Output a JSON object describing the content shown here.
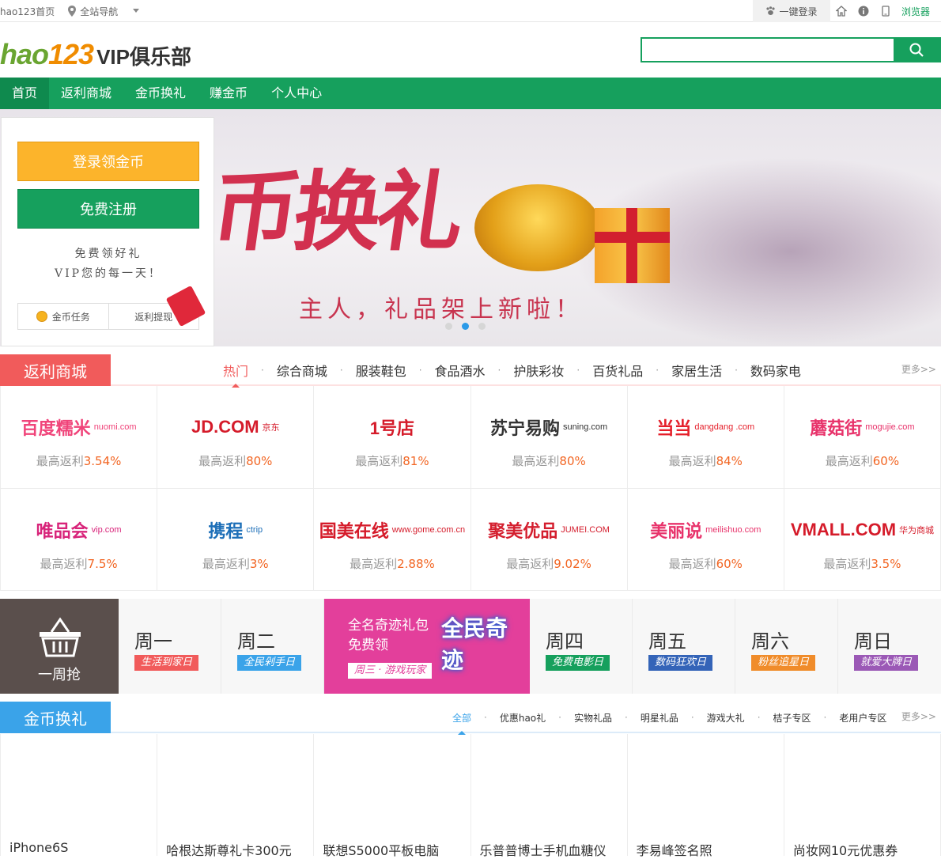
{
  "topbar": {
    "home": "hao123首页",
    "sitenav": "全站导航",
    "login": "一键登录",
    "browser": "浏览器"
  },
  "header": {
    "logo_hao": "hao",
    "logo_num": "123",
    "logo_vip": "VIP俱乐部",
    "search_placeholder": ""
  },
  "nav": {
    "items": [
      "首页",
      "返利商城",
      "金币换礼",
      "赚金币",
      "个人中心"
    ]
  },
  "banner": {
    "headline": "币换礼",
    "subtitle": "主人，礼品架上新啦！"
  },
  "login_box": {
    "login_button": "登录领金币",
    "register_button": "免费注册",
    "slogan_line1": "免费领好礼",
    "slogan_line2": "VIP您的每一天！",
    "task_label": "金币任务",
    "withdraw_label": "返利提现"
  },
  "rebate": {
    "title": "返利商城",
    "tabs": [
      "热门",
      "综合商城",
      "服装鞋包",
      "食品酒水",
      "护肤彩妆",
      "百货礼品",
      "家居生活",
      "数码家电"
    ],
    "more": "更多>>",
    "rate_prefix": "最高返利",
    "stores": [
      {
        "name": "百度糯米",
        "sub": "nuomi.com",
        "color": "#f0447a",
        "rate": "3.54%"
      },
      {
        "name": "JD.COM",
        "sub": "京东",
        "color": "#d51b2a",
        "rate": "80%"
      },
      {
        "name": "1号店",
        "sub": "",
        "color": "#d51b2a",
        "rate": "81%"
      },
      {
        "name": "苏宁易购",
        "sub": "suning.com",
        "color": "#333333",
        "rate": "80%"
      },
      {
        "name": "当当",
        "sub": "dangdang .com",
        "color": "#e5202b",
        "rate": "84%"
      },
      {
        "name": "蘑菇街",
        "sub": "mogujie.com",
        "color": "#e8336b",
        "rate": "60%"
      },
      {
        "name": "唯品会",
        "sub": "vip.com",
        "color": "#d8247a",
        "rate": "7.5%"
      },
      {
        "name": "携程",
        "sub": "ctrip",
        "color": "#1d6fb8",
        "rate": "3%"
      },
      {
        "name": "国美在线",
        "sub": "www.gome.com.cn",
        "color": "#d51b2a",
        "rate": "2.88%"
      },
      {
        "name": "聚美优品",
        "sub": "JUMEI.COM",
        "color": "#d41e2e",
        "rate": "9.02%"
      },
      {
        "name": "美丽说",
        "sub": "meilishuo.com",
        "color": "#e8336b",
        "rate": "60%"
      },
      {
        "name": "VMALL.COM",
        "sub": "华为商城",
        "color": "#d51b2a",
        "rate": "3.5%"
      }
    ]
  },
  "weekly": {
    "title": "一周抢",
    "days": [
      {
        "name": "周一",
        "tag": "生活到家日",
        "color": "#f15b5b"
      },
      {
        "name": "周二",
        "tag": "全民剁手日",
        "color": "#3aa3e9"
      },
      {
        "name": "周四",
        "tag": "免费电影日",
        "color": "#16a05d"
      },
      {
        "name": "周五",
        "tag": "数码狂欢日",
        "color": "#3464b8"
      },
      {
        "name": "周六",
        "tag": "粉丝追星日",
        "color": "#f08c2a"
      },
      {
        "name": "周日",
        "tag": "就爱大牌日",
        "color": "#9b59b6"
      }
    ],
    "promo_line1": "全名奇迹礼包",
    "promo_line2": "免费领",
    "promo_tag": "周三 · 游戏玩家",
    "promo_game": "全民奇迹"
  },
  "gold": {
    "title": "金币换礼",
    "tabs": [
      "全部",
      "优惠hao礼",
      "实物礼品",
      "明星礼品",
      "游戏大礼",
      "桔子专区",
      "老用户专区"
    ],
    "more": "更多>>",
    "items": [
      "iPhone6S",
      "哈根达斯尊礼卡300元",
      "联想S5000平板电脑",
      "乐普普博士手机血糖仪",
      "李易峰签名照",
      "尚妆网10元优惠券"
    ]
  }
}
